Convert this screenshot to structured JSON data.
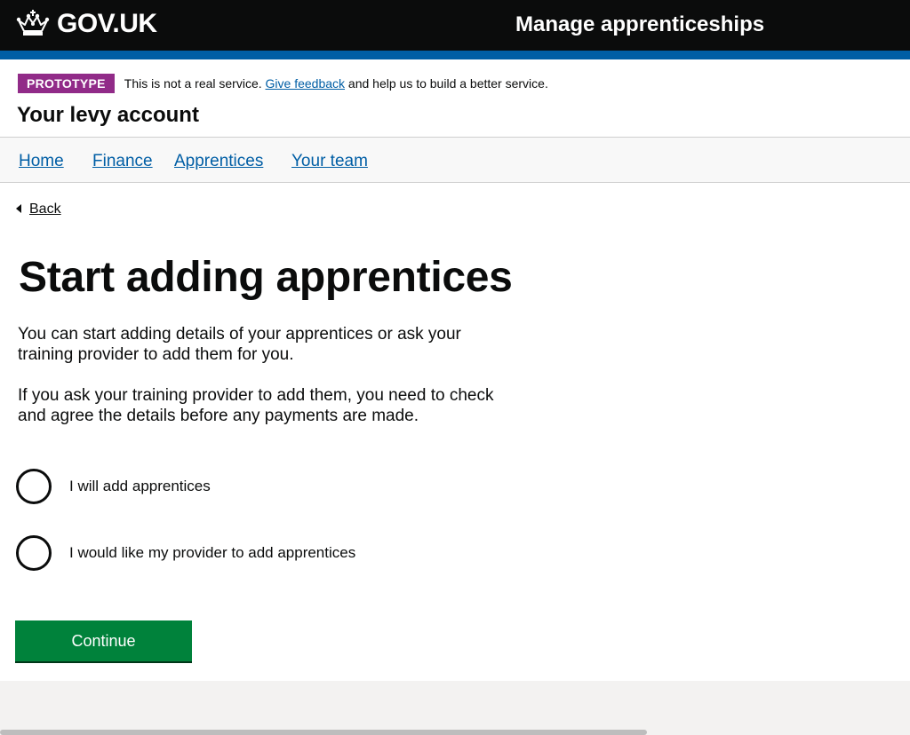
{
  "header": {
    "logo_text": "GOV.UK",
    "logo_icon": "crown-icon",
    "service_name": "Manage apprenticeships",
    "background": "#0b0c0c",
    "stripe_color": "#005ea5"
  },
  "phase_banner": {
    "tag": "PROTOTYPE",
    "tag_color": "#912b88",
    "text_before": "This is not a real service.",
    "link_text": "Give feedback",
    "text_after": "and help us to build a better service."
  },
  "account_title": "Your levy account",
  "nav": {
    "items": [
      {
        "label": "Home"
      },
      {
        "label": "Finance"
      },
      {
        "label": "Apprentices"
      },
      {
        "label": "Your team"
      }
    ]
  },
  "back_link": {
    "label": "Back",
    "icon": "back-arrow-icon"
  },
  "main": {
    "heading": "Start adding apprentices",
    "paragraphs": [
      "You can start adding details of your apprentices or ask your training provider to add them for you.",
      "If you ask your training provider to add them, you need to check and agree the details before any payments are made."
    ],
    "options": [
      {
        "label": "I will add apprentices",
        "selected": false
      },
      {
        "label": "I would like my provider to add apprentices",
        "selected": false
      }
    ],
    "continue_label": "Continue",
    "continue_color": "#00823b"
  }
}
